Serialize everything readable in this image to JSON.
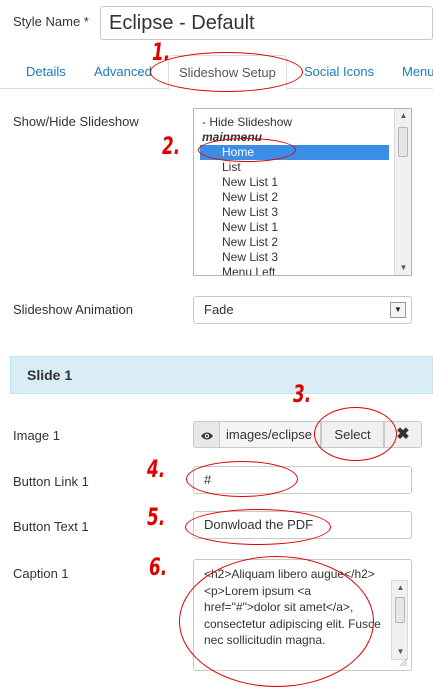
{
  "style_name": {
    "label": "Style Name *",
    "value": "Eclipse - Default"
  },
  "tabs": [
    {
      "label": "Details"
    },
    {
      "label": "Advanced"
    },
    {
      "label": "Slideshow Setup"
    },
    {
      "label": "Social Icons"
    },
    {
      "label": "Menu"
    }
  ],
  "show_hide": {
    "label": "Show/Hide Slideshow",
    "options": [
      {
        "label": "- Hide Slideshow"
      },
      {
        "label": "mainmenu"
      },
      {
        "label": "Home"
      },
      {
        "label": "List"
      },
      {
        "label": "New List 1"
      },
      {
        "label": "New List 2"
      },
      {
        "label": "New List 3"
      },
      {
        "label": "New List 1"
      },
      {
        "label": "New List 2"
      },
      {
        "label": "New List 3"
      },
      {
        "label": "Menu Left"
      }
    ]
  },
  "animation": {
    "label": "Slideshow Animation",
    "value": "Fade"
  },
  "slide": {
    "title": "Slide 1"
  },
  "image": {
    "label": "Image 1",
    "path": "images/eclipse",
    "select_label": "Select",
    "clear_label": "✖",
    "preview_icon": "eye-icon"
  },
  "button_link": {
    "label": "Button Link 1",
    "value": "#"
  },
  "button_text": {
    "label": "Button Text 1",
    "value": "Donwload the PDF"
  },
  "caption": {
    "label": "Caption 1",
    "value": "<h2>Aliquam libero augue</h2>\n<p>Lorem ipsum <a href=\"#\">dolor sit amet</a>, consectetur adipiscing elit. Fusce nec sollicitudin magna."
  },
  "annotations": {
    "n1": "1.",
    "n2": "2.",
    "n3": "3.",
    "n4": "4.",
    "n5": "5.",
    "n6": "6."
  },
  "colors": {
    "annotation": "#e00000",
    "link": "#1a7bb9",
    "selected": "#3a8ee6",
    "panel": "#d9edf7"
  }
}
